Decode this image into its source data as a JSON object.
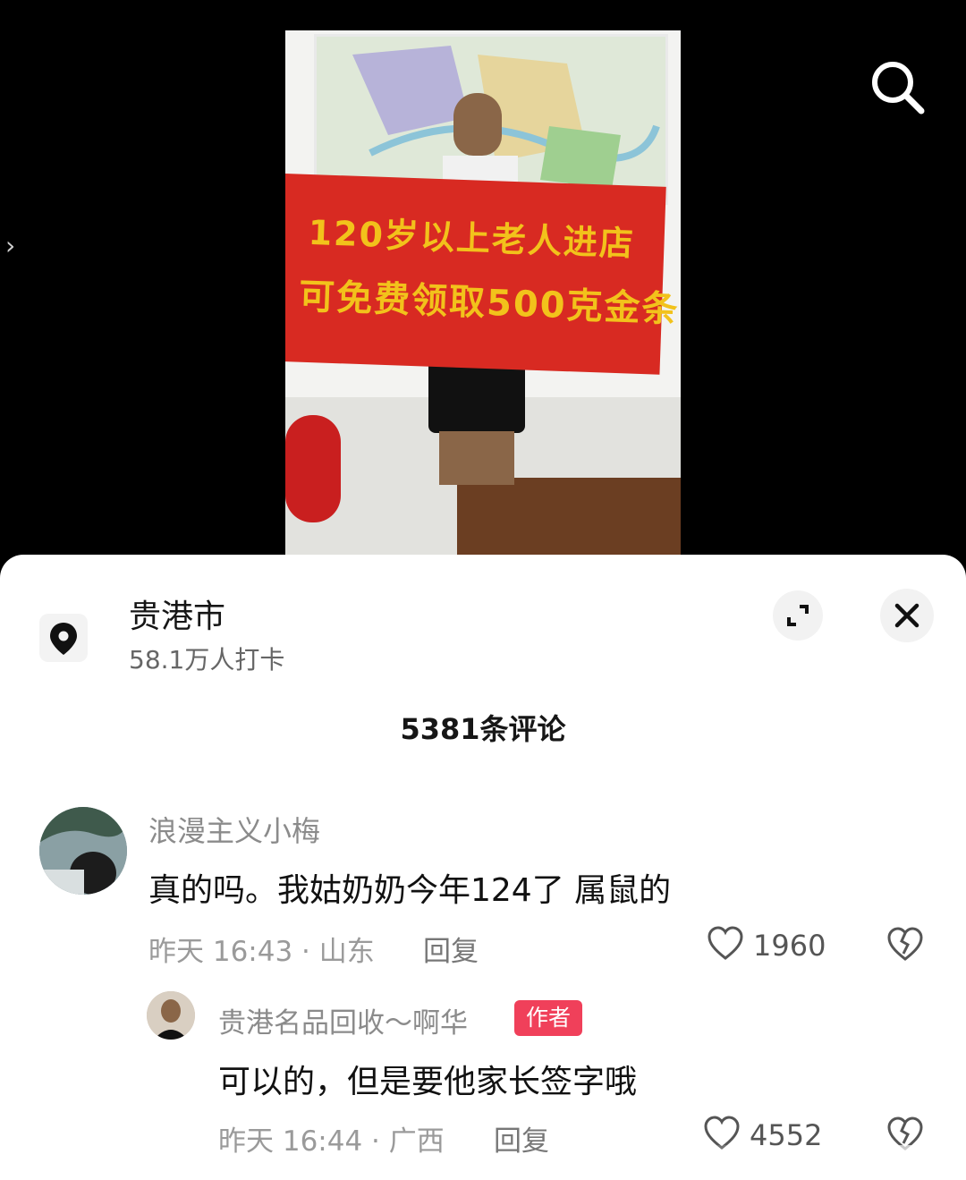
{
  "video": {
    "banner_line1": "120岁以上老人进店",
    "banner_line2": "可免费领取500克金条",
    "icons": {
      "search": "search-icon",
      "side": "chevron-right-icon"
    }
  },
  "location": {
    "name": "贵港市",
    "checkins": "58.1万人打卡",
    "icon": "location-pin-icon"
  },
  "comments_header": {
    "count_label": "5381条评论"
  },
  "comments": [
    {
      "username": "浪漫主义小梅",
      "text": "真的吗。我姑奶奶今年124了 属鼠的",
      "meta": "昨天 16:43 · 山东",
      "reply_label": "回复",
      "likes": "1960"
    },
    {
      "username": "贵港名品回收～啊华",
      "badge": "作者",
      "text": "可以的，但是要他家长签字哦",
      "meta": "昨天 16:44 · 广西",
      "reply_label": "回复",
      "likes": "4552"
    }
  ],
  "colors": {
    "badge": "#f0405a",
    "banner": "#d82a22",
    "banner_text": "#f2c21b"
  }
}
